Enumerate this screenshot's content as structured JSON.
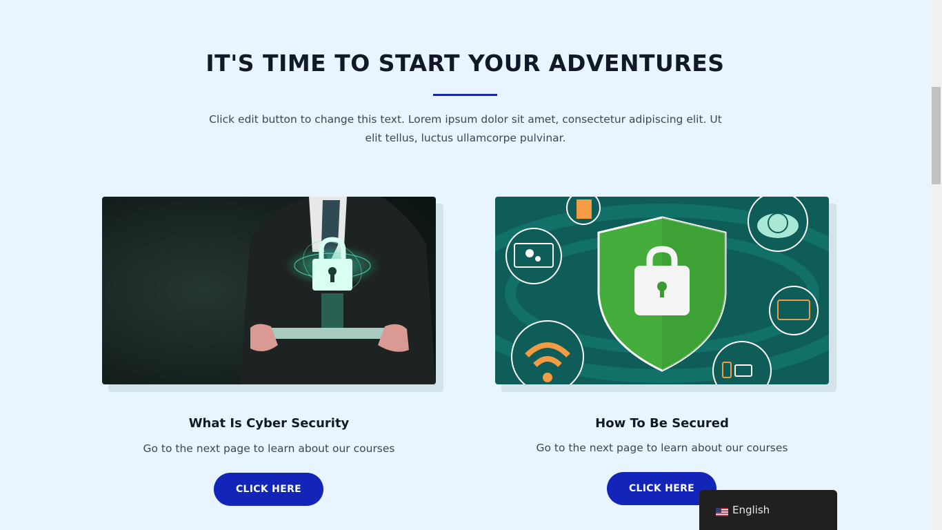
{
  "section": {
    "heading": "IT'S TIME TO START YOUR ADVENTURES",
    "intro": "Click edit button to change this text. Lorem ipsum dolor sit amet, consectetur adipiscing elit. Ut elit tellus, luctus ullamcorpe pulvinar."
  },
  "cards": [
    {
      "title": "What Is Cyber Security",
      "text": "Go to the next page to learn about our courses",
      "button": "CLICK HERE"
    },
    {
      "title": "How To Be Secured",
      "text": "Go to the next page to learn about our courses",
      "button": "CLICK HERE"
    }
  ],
  "language_switcher": {
    "label": "English",
    "flag_icon": "us-flag-icon"
  },
  "colors": {
    "background": "#e9f5fe",
    "accent": "#1225b8",
    "heading": "#111827"
  }
}
